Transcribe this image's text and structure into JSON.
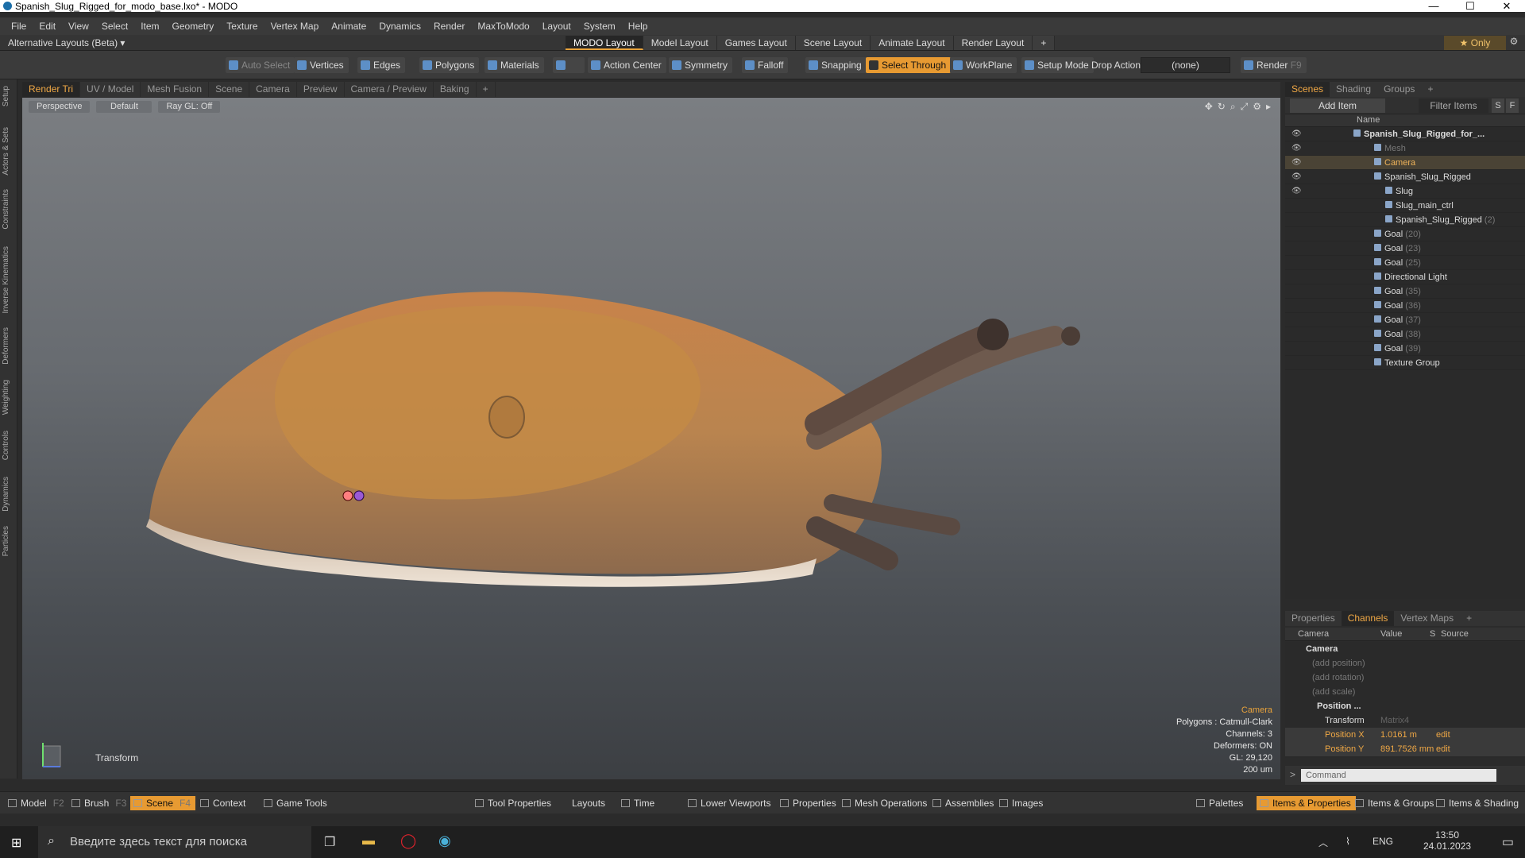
{
  "window": {
    "title": "Spanish_Slug_Rigged_for_modo_base.lxo* - MODO",
    "minimize": "—",
    "maximize": "☐",
    "close": "✕"
  },
  "menu": [
    "File",
    "Edit",
    "View",
    "Select",
    "Item",
    "Geometry",
    "Texture",
    "Vertex Map",
    "Animate",
    "Dynamics",
    "Render",
    "MaxToModo",
    "Layout",
    "System",
    "Help"
  ],
  "layoutbar": {
    "alt_layouts": "Alternative Layouts (Beta) ▾",
    "tabs": [
      "MODO Layout",
      "Model Layout",
      "Games Layout",
      "Scene Layout",
      "Animate Layout",
      "Render Layout"
    ],
    "active_tab": "MODO Layout",
    "add": "+",
    "only": "★  Only",
    "gear": "⚙"
  },
  "toolbar": {
    "auto_select": "Auto Select",
    "vertices": "Vertices",
    "edges": "Edges",
    "polygons": "Polygons",
    "materials": "Materials",
    "action_center": "Action Center",
    "symmetry": "Symmetry",
    "falloff": "Falloff",
    "snapping": "Snapping",
    "select_through": "Select Through",
    "workplane": "WorkPlane",
    "setup_mode": "Setup Mode",
    "drop_action": "Drop Action",
    "drop_value": "(none)",
    "render": "Render",
    "render_key": "F9"
  },
  "left_strip": [
    "Setup",
    "Actors & Sets",
    "Constraints",
    "Inverse Kinematics",
    "Deformers",
    "Weighting",
    "Controls",
    "Dynamics",
    "Particles"
  ],
  "viewport_tabs": [
    "Render Tri",
    "UV / Model",
    "Mesh Fusion",
    "Scene",
    "Camera",
    "Preview",
    "Camera / Preview",
    "Baking",
    "+"
  ],
  "viewport": {
    "perspective": "Perspective",
    "default": "Default",
    "raygl": "Ray GL: Off",
    "transform": "Transform",
    "info": {
      "camera": "Camera",
      "polygons": "Polygons : Catmull-Clark",
      "channels": "Channels: 3",
      "deformers": "Deformers: ON",
      "gl": "GL: 29,120",
      "scale": "200 um"
    }
  },
  "scenes": {
    "tabs": [
      "Scenes",
      "Shading",
      "Groups",
      "+"
    ],
    "add_item": "Add Item",
    "filter_items": "Filter Items",
    "s_btn": "S",
    "f_btn": "F",
    "col_name": "Name",
    "items": [
      {
        "label": "Spanish_Slug_Rigged_for_...",
        "suffix": "",
        "indent": 0
      },
      {
        "label": "Mesh",
        "suffix": "",
        "indent": 1
      },
      {
        "label": "Camera",
        "suffix": "",
        "indent": 1
      },
      {
        "label": "Spanish_Slug_Rigged",
        "suffix": "",
        "indent": 1
      },
      {
        "label": "Slug",
        "suffix": "",
        "indent": 2
      },
      {
        "label": "Slug_main_ctrl",
        "suffix": "",
        "indent": 2
      },
      {
        "label": "Spanish_Slug_Rigged",
        "suffix": " (2)",
        "indent": 2
      },
      {
        "label": "Goal",
        "suffix": " (20)",
        "indent": 1
      },
      {
        "label": "Goal",
        "suffix": " (23)",
        "indent": 1
      },
      {
        "label": "Goal",
        "suffix": " (25)",
        "indent": 1
      },
      {
        "label": "Directional Light",
        "suffix": "",
        "indent": 1
      },
      {
        "label": "Goal",
        "suffix": " (35)",
        "indent": 1
      },
      {
        "label": "Goal",
        "suffix": " (36)",
        "indent": 1
      },
      {
        "label": "Goal",
        "suffix": " (37)",
        "indent": 1
      },
      {
        "label": "Goal",
        "suffix": " (38)",
        "indent": 1
      },
      {
        "label": "Goal",
        "suffix": " (39)",
        "indent": 1
      },
      {
        "label": "Texture Group",
        "suffix": "",
        "indent": 1
      }
    ]
  },
  "properties": {
    "tabs": [
      "Properties",
      "Channels",
      "Vertex Maps",
      "+"
    ],
    "col_camera": "Camera",
    "col_value": "Value",
    "col_s": "S",
    "col_source": "Source",
    "rows": [
      {
        "label": "Camera",
        "value": "",
        "source": ""
      },
      {
        "label": "(add position)",
        "value": "",
        "source": ""
      },
      {
        "label": "(add rotation)",
        "value": "",
        "source": ""
      },
      {
        "label": "(add scale)",
        "value": "",
        "source": ""
      },
      {
        "label": "Position ...",
        "value": "",
        "source": ""
      },
      {
        "label": "Transform",
        "value": "Matrix4",
        "source": ""
      },
      {
        "label": "Position X",
        "value": "1.0161 m",
        "source": "edit"
      },
      {
        "label": "Position Y",
        "value": "891.7526 mm",
        "source": "edit"
      }
    ],
    "command_placeholder": "Command"
  },
  "bottombar": {
    "model": "Model",
    "model_key": "F2",
    "brush": "Brush",
    "brush_key": "F3",
    "scene": "Scene",
    "scene_key": "F4",
    "context": "Context",
    "game_tools": "Game Tools",
    "tool_properties": "Tool Properties",
    "layouts": "Layouts",
    "time": "Time",
    "lower_viewports": "Lower Viewports",
    "properties": "Properties",
    "mesh_operations": "Mesh Operations",
    "assemblies": "Assemblies",
    "images": "Images",
    "palettes": "Palettes",
    "items_properties": "Items & Properties",
    "items_groups": "Items & Groups",
    "items_shading": "Items & Shading"
  },
  "taskbar": {
    "search": "Введите здесь текст для поиска",
    "lang": "ENG",
    "time": "13:50",
    "date": "24.01.2023"
  }
}
